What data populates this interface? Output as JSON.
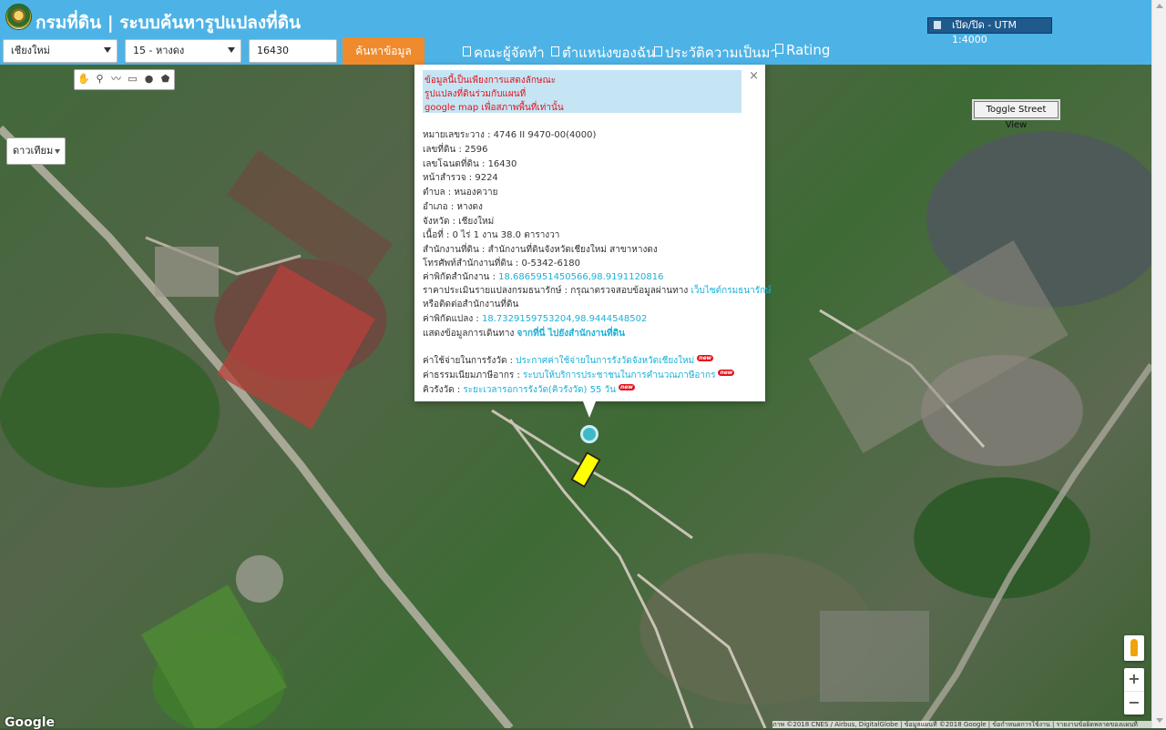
{
  "header": {
    "logo_icon": "department-of-lands-seal-icon",
    "title": "กรมที่ดิน | ระบบค้นหารูปแปลงที่ดิน",
    "utm_toggle": "เปิด/ปิด - UTM 1:4000"
  },
  "search": {
    "province": "เชียงใหม่",
    "district": "15 - หางดง",
    "parcel_number": "16430",
    "submit_label": "ค้นหาข้อมูล"
  },
  "nav": {
    "items": [
      "คณะผู้จัดทำ",
      "ตำแหน่งของฉัน",
      "ประวัติความเป็นมา",
      "Rating"
    ]
  },
  "map": {
    "type_select": "ดาวเทียม",
    "tools": [
      "hand-icon",
      "marker-icon",
      "polyline-icon",
      "rectangle-icon",
      "circle-icon",
      "polygon-icon"
    ],
    "street_view_toggle": "Toggle Street View",
    "google_logo": "Google",
    "copyright": "ภาพ ©2018 CNES / Airbus, DigitalGlobe | ข้อมูลแผนที่ ©2018 Google | ข้อกำหนดการใช้งาน | รายงานข้อผิดพลาดของแผนที่",
    "zoom_in": "+",
    "zoom_out": "−",
    "accent_color": "#ffff00"
  },
  "popup": {
    "close": "×",
    "notice": [
      "ข้อมูลนี้เป็นเพียงการแสดงลักษณะ",
      "รูปแปลงที่ดินร่วมกับแผนที่",
      "google map เพื่อสภาพพื้นที่เท่านั้น"
    ],
    "fields": [
      {
        "label": "หมายเลขระวาง",
        "value": "4746 II 9470-00(4000)"
      },
      {
        "label": "เลขที่ดิน",
        "value": "2596"
      },
      {
        "label": "เลขโฉนดที่ดิน",
        "value": "16430"
      },
      {
        "label": "หน้าสำรวจ",
        "value": "9224"
      },
      {
        "label": "ตำบล",
        "value": "หนองควาย"
      },
      {
        "label": "อำเภอ",
        "value": "หางดง"
      },
      {
        "label": "จังหวัด",
        "value": "เชียงใหม่"
      },
      {
        "label": "เนื้อที่",
        "value": "0 ไร่ 1 งาน 38.0 ตารางวา"
      },
      {
        "label": "สำนักงานที่ดิน",
        "value": "สำนักงานที่ดินจังหวัดเชียงใหม่ สาขาหางดง"
      },
      {
        "label": "โทรศัพท์สำนักงานที่ดิน",
        "value": "0-5342-6180"
      }
    ],
    "office_coord_label": "ค่าพิกัดสำนักงาน : ",
    "office_coord": "18.6865951450566,98.9191120816",
    "appraisal_label": "ราคาประเมินรายแปลงกรมธนารักษ์ : กรุณาตรวจสอบข้อมูลผ่านทาง ",
    "appraisal_link": "เว็บไซต์กรมธนารักษ์",
    "appraisal_line2": "หรือติดต่อสำนักงานที่ดิน",
    "parcel_coord_label": "ค่าพิกัดแปลง : ",
    "parcel_coord": "18.7329159753204,98.9444548502",
    "route_label": "แสดงข้อมูลการเดินทาง ",
    "route_link": "จากที่นี่ ไปยังสำนักงานที่ดิน",
    "extra": [
      {
        "label": "ค่าใช้จ่ายในการรังวัด : ",
        "link": "ประกาศค่าใช้จ่ายในการรังวัดจังหวัดเชียงใหม่",
        "badge": "new"
      },
      {
        "label": "ค่าธรรมเนียมภาษีอากร : ",
        "link": "ระบบให้บริการประชาชนในการคำนวณภาษีอากร",
        "badge": "new"
      },
      {
        "label": "คิวรังวัด : ",
        "link": "ระยะเวลารอการรังวัด(คิวรังวัด) 55 วัน",
        "badge": "new"
      }
    ]
  }
}
